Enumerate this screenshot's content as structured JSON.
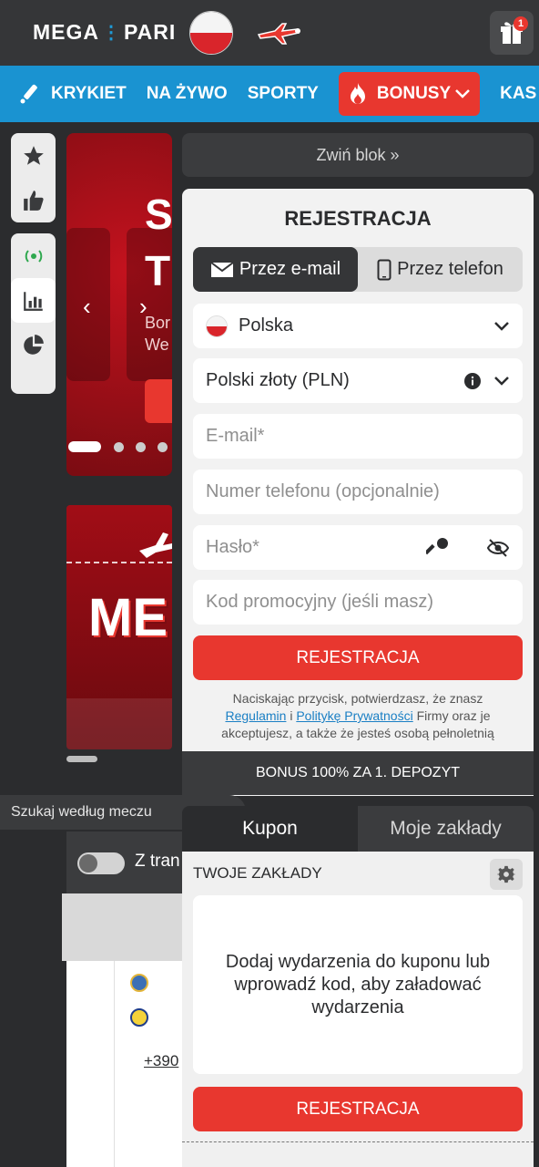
{
  "header": {
    "logo_left": "MEGA",
    "logo_right": "PARI",
    "gift_badge": "1"
  },
  "nav": {
    "items": [
      "KRYKIET",
      "NA ŻYWO",
      "SPORTY",
      "BONUSY",
      "KAS"
    ]
  },
  "left": {
    "banner1_big": "S",
    "banner1_big2": "T",
    "banner1_small1": "Bor",
    "banner1_small2": "We",
    "banner2_text": "ME"
  },
  "collapse": {
    "label": "Zwiń blok »"
  },
  "registration": {
    "title": "REJESTRACJA",
    "tab_email": "Przez e-mail",
    "tab_phone": "Przez telefon",
    "country": "Polska",
    "currency": "Polski złoty (PLN)",
    "email_placeholder": "E-mail*",
    "phone_placeholder": "Numer telefonu (opcjonalnie)",
    "password_placeholder": "Hasło*",
    "promo_placeholder": "Kod promocyjny (jeśli masz)",
    "submit": "REJESTRACJA",
    "legal_1": "Naciskając przycisk, potwierdzasz, że znasz",
    "legal_link1": "Regulamin",
    "legal_and": "i",
    "legal_link2": "Politykę Prywatności",
    "legal_2": "Firmy oraz je akceptujesz, a także że jesteś osobą pełnoletnią"
  },
  "bonus_bar": "BONUS 100% ZA 1. DEPOZYT",
  "search": {
    "label": "Szukaj według meczu"
  },
  "lower_left": {
    "toggle_label": "Z tran",
    "odds_more": "+390"
  },
  "coupon": {
    "tab_coupon": "Kupon",
    "tab_bets": "Moje zakłady",
    "title": "TWOJE ZAKŁADY",
    "empty_text": "Dodaj wydarzenia do kuponu lub wprowadź kod, aby załadować wydarzenia",
    "submit": "REJESTRACJA"
  },
  "colors": {
    "accent_blue": "#1a93d1",
    "accent_red": "#e8372f",
    "dark_bg": "#2b2c2e"
  }
}
